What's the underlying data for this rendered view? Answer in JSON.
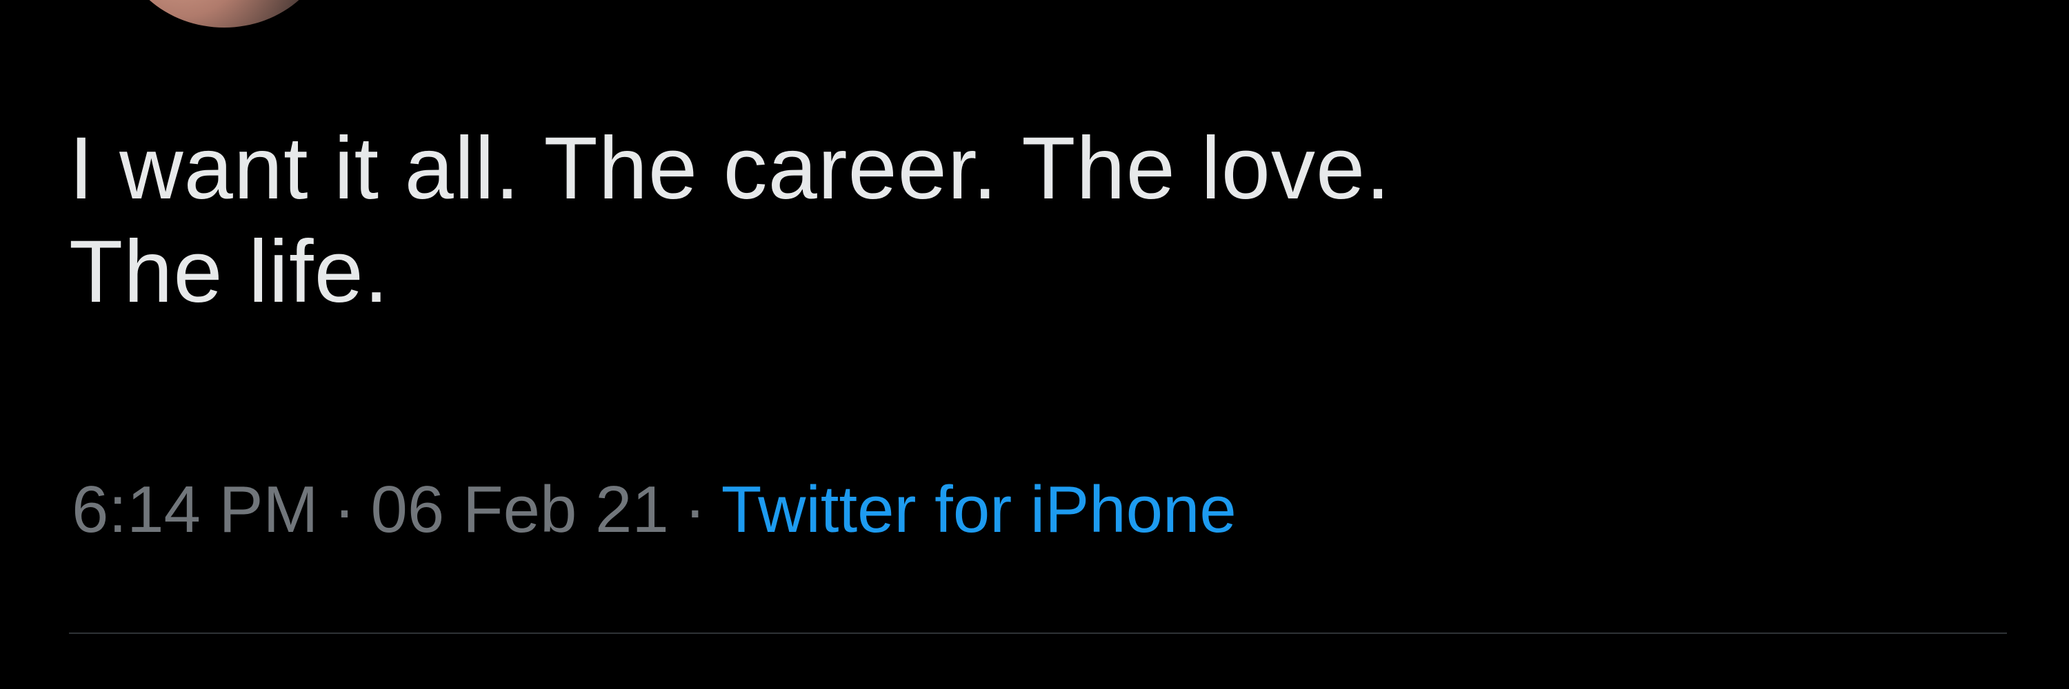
{
  "tweet": {
    "text_line1": "I want it all. The career. The love.",
    "text_line2": "The life.",
    "time": "6:14 PM",
    "date": "06 Feb 21",
    "separator": "·",
    "source": "Twitter for iPhone"
  },
  "colors": {
    "background": "#000000",
    "text": "#e7e9ea",
    "meta": "#71767b",
    "link": "#1d9bf0",
    "divider": "#2f3336"
  }
}
